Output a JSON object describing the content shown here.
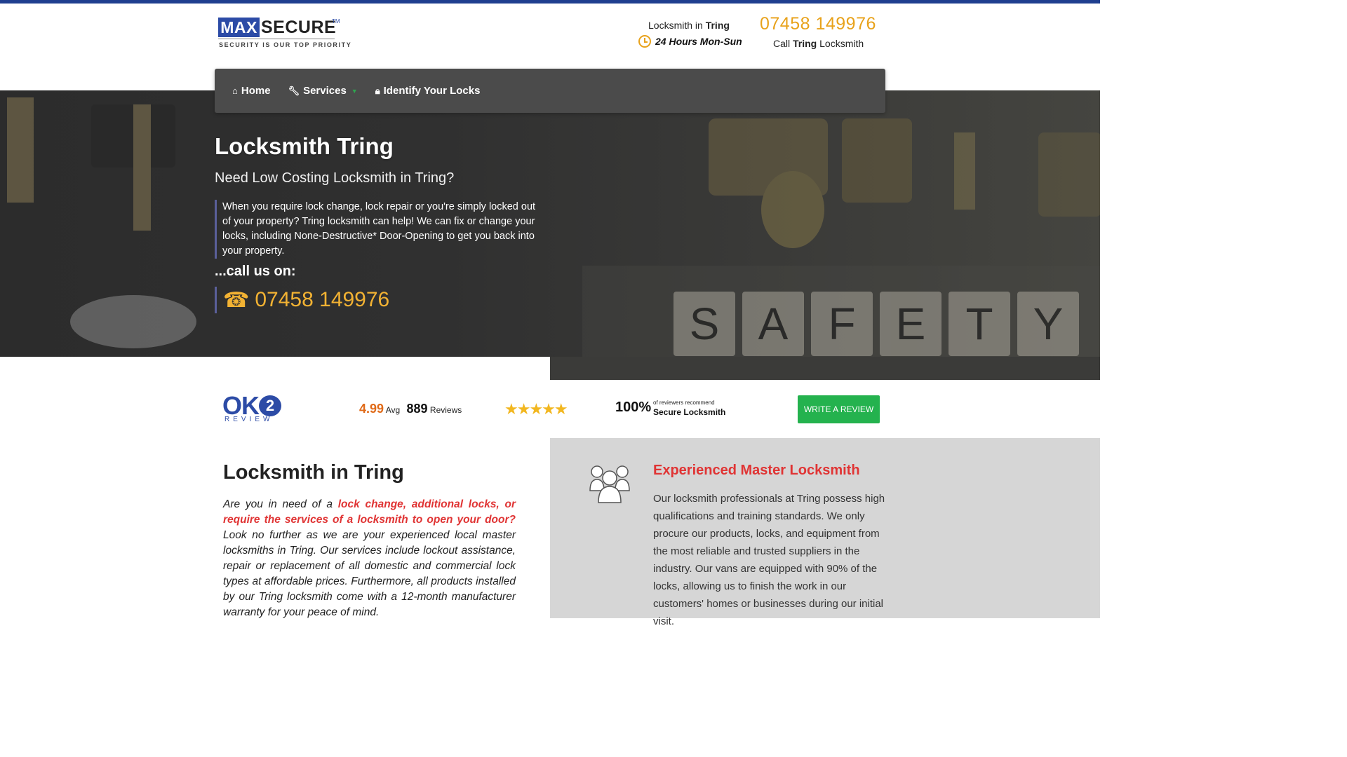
{
  "header": {
    "logo": {
      "box_text": "MAX",
      "word": "SECURE",
      "tm": "TM",
      "tagline": "SECURITY IS OUR TOP PRIORITY"
    },
    "locksmith_prefix": "Locksmith in ",
    "locksmith_town": "Tring",
    "hours": "24 Hours Mon-Sun",
    "phone": "07458 149976",
    "call_prefix": "Call ",
    "call_town": "Tring",
    "call_suffix": " Locksmith"
  },
  "nav": {
    "items": [
      {
        "label": "Home",
        "icon": "home-icon"
      },
      {
        "label": "Services",
        "icon": "wrench-icon"
      },
      {
        "label": "Identify Your Locks",
        "icon": "lock-icon"
      }
    ]
  },
  "hero": {
    "title": "Locksmith Tring",
    "subtitle": "Need Low Costing Locksmith in Tring?",
    "quote": "When you require lock change, lock repair or you're simply locked out of your property? Tring locksmith can help! We can fix or change your locks, including None-Destructive* Door-Opening to get you back into your property.",
    "call_us": "...call us on:",
    "phone_icon": "☎",
    "phone": "07458 149976",
    "safety_letters": [
      "S",
      "A",
      "F",
      "E",
      "T",
      "Y"
    ]
  },
  "reviews": {
    "brand_word": "OK",
    "brand_digit": "2",
    "brand_sub": "REVIEW",
    "average": "4.99",
    "avg_label": "Avg",
    "count": "889",
    "count_label": "Reviews",
    "stars": "★★★★★",
    "percent": "100%",
    "percent_small": "of reviewers recommend",
    "percent_label": "Secure Locksmith",
    "write_button": "WRITE A REVIEW"
  },
  "main": {
    "title": "Locksmith in Tring",
    "intro": "Are you in need of a ",
    "highlight": "lock change, additional locks, or require the services of a locksmith to open your door?",
    "body": " Look no further as we are your experienced local master locksmiths in Tring. Our services include lockout assistance, repair or replacement of all domestic and commercial lock types at affordable prices. Furthermore, all products installed by our Tring locksmith come with a 12-month manufacturer warranty for your peace of mind."
  },
  "panel": {
    "icon": "people-icon",
    "title": "Experienced Master Locksmith",
    "body": "Our locksmith professionals at Tring possess high qualifications and training standards. We only procure our products, locks, and equipment from the most reliable and trusted suppliers in the industry. Our vans are equipped with 90% of the locks, allowing us to finish the work in our customers' homes or businesses during our initial visit."
  },
  "colors": {
    "brand_blue": "#2c4ba6",
    "accent_orange": "#e8a21b",
    "highlight_red": "#e03434",
    "button_green": "#24b24e"
  }
}
